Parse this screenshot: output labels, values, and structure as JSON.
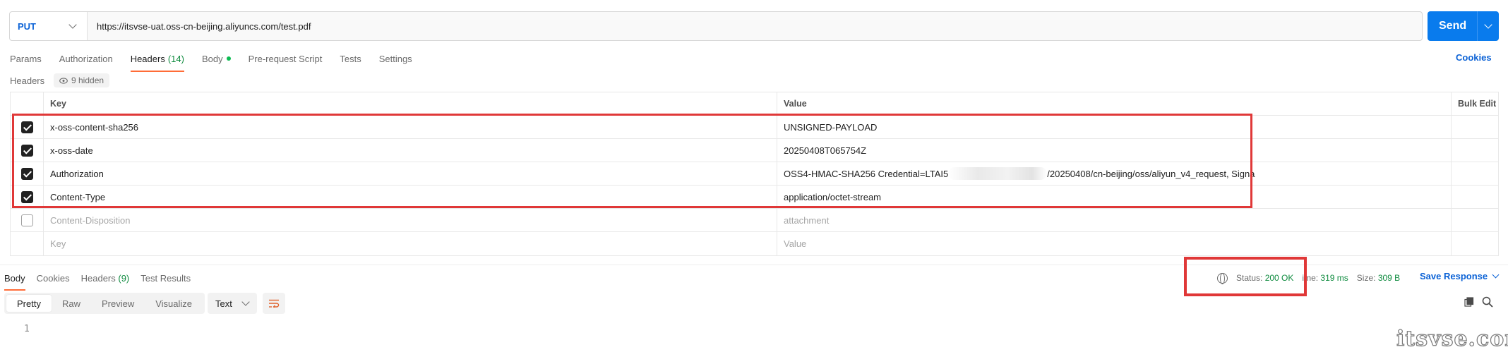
{
  "request": {
    "method": "PUT",
    "url": "https://itsvse-uat.oss-cn-beijing.aliyuncs.com/test.pdf",
    "send_label": "Send"
  },
  "req_tabs": {
    "params": "Params",
    "authorization": "Authorization",
    "headers": "Headers",
    "headers_count": "(14)",
    "body": "Body",
    "prerequest": "Pre-request Script",
    "tests": "Tests",
    "settings": "Settings"
  },
  "cookies_label": "Cookies",
  "headers_section": {
    "label": "Headers",
    "hidden_label": "9 hidden"
  },
  "table": {
    "col_key": "Key",
    "col_value": "Value",
    "col_bulk": "Bulk Edit",
    "rows": [
      {
        "key": "x-oss-content-sha256",
        "value": "UNSIGNED-PAYLOAD",
        "checked": true
      },
      {
        "key": "x-oss-date",
        "value": "20250408T065754Z",
        "checked": true
      },
      {
        "key": "Authorization",
        "value_prefix": "OSS4-HMAC-SHA256 Credential=LTAI5",
        "value_suffix": "/20250408/cn-beijing/oss/aliyun_v4_request, Signa",
        "checked": true
      },
      {
        "key": "Content-Type",
        "value": "application/octet-stream",
        "checked": true
      },
      {
        "key": "Content-Disposition",
        "value": "attachment",
        "checked": false
      }
    ],
    "placeholder_key": "Key",
    "placeholder_value": "Value"
  },
  "response": {
    "tabs": {
      "body": "Body",
      "cookies": "Cookies",
      "headers": "Headers",
      "headers_count": "(9)",
      "test_results": "Test Results"
    },
    "status_label": "Status:",
    "status_value": "200 OK",
    "time_label": "ime:",
    "time_value": "319 ms",
    "size_label": "Size:",
    "size_value": "309 B",
    "save_label": "Save Response",
    "views": [
      "Pretty",
      "Raw",
      "Preview",
      "Visualize"
    ],
    "format": "Text",
    "line_number": "1"
  },
  "watermark": "itsvse.com",
  "colors": {
    "accent_orange": "#ff6c37",
    "send_blue": "#097bed",
    "link_blue": "#0b62d6",
    "status_green": "#0f8b3f",
    "highlight_red": "#e03838"
  }
}
